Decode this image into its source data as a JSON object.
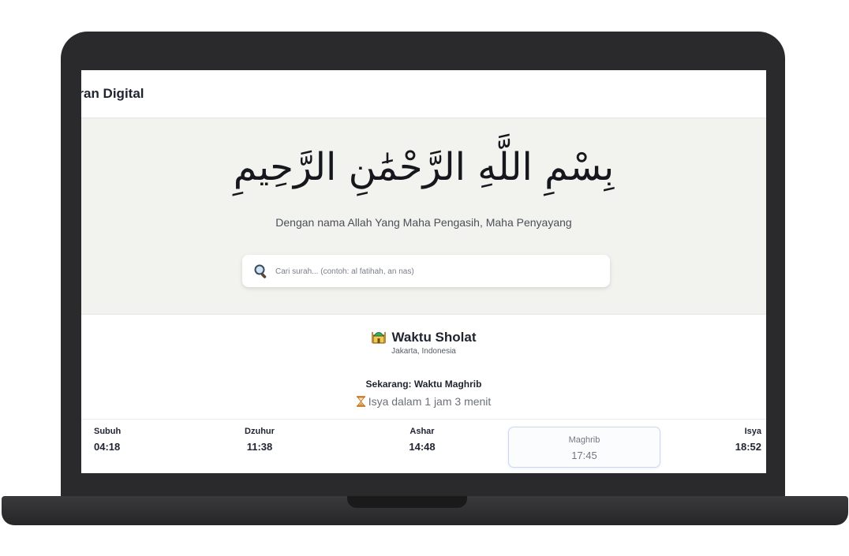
{
  "app": {
    "title": "uran Digital"
  },
  "hero": {
    "bismillah": "بِسْمِ اللَّهِ الرَّحْمَٰنِ الرَّحِيمِ",
    "translation": "Dengan nama Allah Yang Maha Pengasih, Maha Penyayang"
  },
  "search": {
    "placeholder": "Cari surah... (contoh: al fatihah, an nas)"
  },
  "prayer": {
    "heading": "Waktu Sholat",
    "location": "Jakarta, Indonesia",
    "current": "Sekarang: Waktu Maghrib",
    "next": "Isya dalam 1 jam 3 menit",
    "times": [
      {
        "name": "Subuh",
        "time": "04:18"
      },
      {
        "name": "Dzuhur",
        "time": "11:38"
      },
      {
        "name": "Ashar",
        "time": "14:48"
      },
      {
        "name": "Maghrib",
        "time": "17:45",
        "active": true
      },
      {
        "name": "Isya",
        "time": "18:52"
      }
    ]
  },
  "colors": {
    "hero_bg": "#f2f2ee",
    "frame": "#2a2a2c",
    "active_border": "#c9d8ef"
  },
  "icons": {
    "search": "magnifier-icon",
    "mosque": "mosque-icon",
    "timer": "hourglass-icon"
  }
}
